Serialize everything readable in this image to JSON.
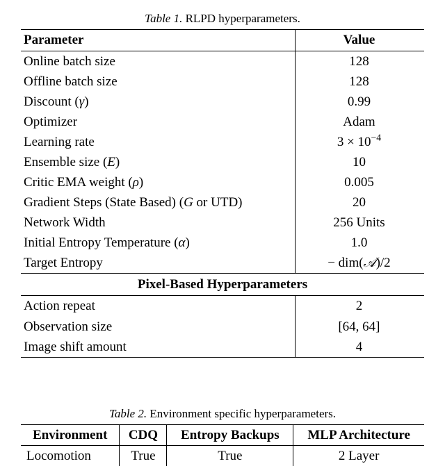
{
  "table1": {
    "caption_prefix": "Table 1.",
    "caption_text": " RLPD hyperparameters.",
    "header": {
      "param": "Parameter",
      "value": "Value"
    },
    "rows": [
      {
        "param": "Online batch size",
        "value": "128"
      },
      {
        "param": "Offline batch size",
        "value": "128"
      },
      {
        "param": "Discount (γ)",
        "value": "0.99"
      },
      {
        "param": "Optimizer",
        "value": "Adam"
      },
      {
        "param": "Learning rate",
        "value": "3 × 10⁻⁴"
      },
      {
        "param": "Ensemble size (E)",
        "value": "10"
      },
      {
        "param": "Critic EMA weight (ρ)",
        "value": "0.005"
      },
      {
        "param": "Gradient Steps (State Based) (G or UTD)",
        "value": "20"
      },
      {
        "param": "Network Width",
        "value": "256 Units"
      },
      {
        "param": "Initial Entropy Temperature (α)",
        "value": "1.0"
      },
      {
        "param": "Target Entropy",
        "value": "− dim(𝒜)/2"
      }
    ],
    "pixel_section_title": "Pixel-Based Hyperparameters",
    "pixel_rows": [
      {
        "param": "Action repeat",
        "value": "2"
      },
      {
        "param": "Observation size",
        "value": "[64, 64]"
      },
      {
        "param": "Image shift amount",
        "value": "4"
      }
    ]
  },
  "table2": {
    "caption_prefix": "Table 2.",
    "caption_text": " Environment specific hyperparameters.",
    "header": {
      "env": "Environment",
      "cdq": "CDQ",
      "ent": "Entropy Backups",
      "mlp": "MLP Architecture"
    },
    "rows": [
      {
        "env": "Locomotion",
        "cdq": "True",
        "ent": "True",
        "mlp": "2 Layer"
      }
    ]
  },
  "chart_data": {
    "type": "table",
    "tables": [
      {
        "title": "RLPD hyperparameters",
        "columns": [
          "Parameter",
          "Value"
        ],
        "rows": [
          [
            "Online batch size",
            "128"
          ],
          [
            "Offline batch size",
            "128"
          ],
          [
            "Discount (gamma)",
            "0.99"
          ],
          [
            "Optimizer",
            "Adam"
          ],
          [
            "Learning rate",
            "3e-4"
          ],
          [
            "Ensemble size (E)",
            "10"
          ],
          [
            "Critic EMA weight (rho)",
            "0.005"
          ],
          [
            "Gradient Steps (State Based) (G or UTD)",
            "20"
          ],
          [
            "Network Width",
            "256 Units"
          ],
          [
            "Initial Entropy Temperature (alpha)",
            "1.0"
          ],
          [
            "Target Entropy",
            "-dim(A)/2"
          ]
        ],
        "subsections": [
          {
            "title": "Pixel-Based Hyperparameters",
            "rows": [
              [
                "Action repeat",
                "2"
              ],
              [
                "Observation size",
                "[64, 64]"
              ],
              [
                "Image shift amount",
                "4"
              ]
            ]
          }
        ]
      },
      {
        "title": "Environment specific hyperparameters",
        "columns": [
          "Environment",
          "CDQ",
          "Entropy Backups",
          "MLP Architecture"
        ],
        "rows": [
          [
            "Locomotion",
            "True",
            "True",
            "2 Layer"
          ]
        ]
      }
    ]
  }
}
